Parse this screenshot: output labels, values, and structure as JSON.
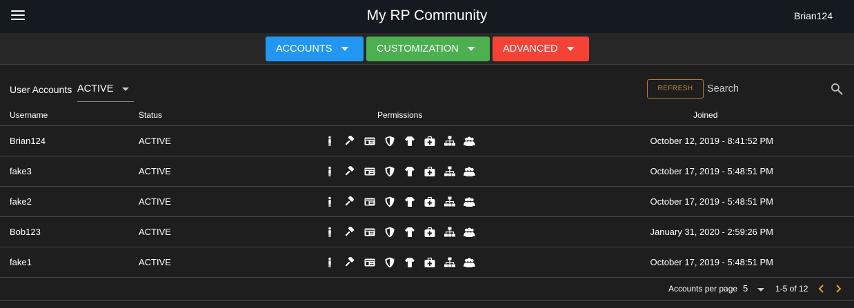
{
  "header": {
    "title": "My RP Community",
    "user": "Brian124"
  },
  "toolbar": {
    "accounts": "ACCOUNTS",
    "customization": "CUSTOMIZATION",
    "advanced": "ADVANCED"
  },
  "filter": {
    "label": "User Accounts",
    "value": "ACTIVE",
    "refresh": "REFRESH",
    "search_placeholder": "Search"
  },
  "columns": {
    "username": "Username",
    "status": "Status",
    "permissions": "Permissions",
    "joined": "Joined"
  },
  "permission_icons": [
    "person-icon",
    "gavel-icon",
    "id-card-icon",
    "shield-icon",
    "shirt-icon",
    "medkit-icon",
    "sitemap-icon",
    "users-icon"
  ],
  "rows": [
    {
      "username": "Brian124",
      "status": "ACTIVE",
      "joined": "October 12, 2019 - 8:41:52 PM"
    },
    {
      "username": "fake3",
      "status": "ACTIVE",
      "joined": "October 17, 2019 - 5:48:51 PM"
    },
    {
      "username": "fake2",
      "status": "ACTIVE",
      "joined": "October 17, 2019 - 5:48:51 PM"
    },
    {
      "username": "Bob123",
      "status": "ACTIVE",
      "joined": "January 31, 2020 - 2:59:26 PM"
    },
    {
      "username": "fake1",
      "status": "ACTIVE",
      "joined": "October 17, 2019 - 5:48:51 PM"
    }
  ],
  "pagination": {
    "per_page_label": "Accounts per page",
    "per_page_value": "5",
    "range": "1-5 of 12"
  },
  "colors": {
    "accounts": "#2196f3",
    "customization": "#4caf50",
    "advanced": "#f44336",
    "refresh": "#c88a3a",
    "pager_arrows": "#e0a030"
  }
}
